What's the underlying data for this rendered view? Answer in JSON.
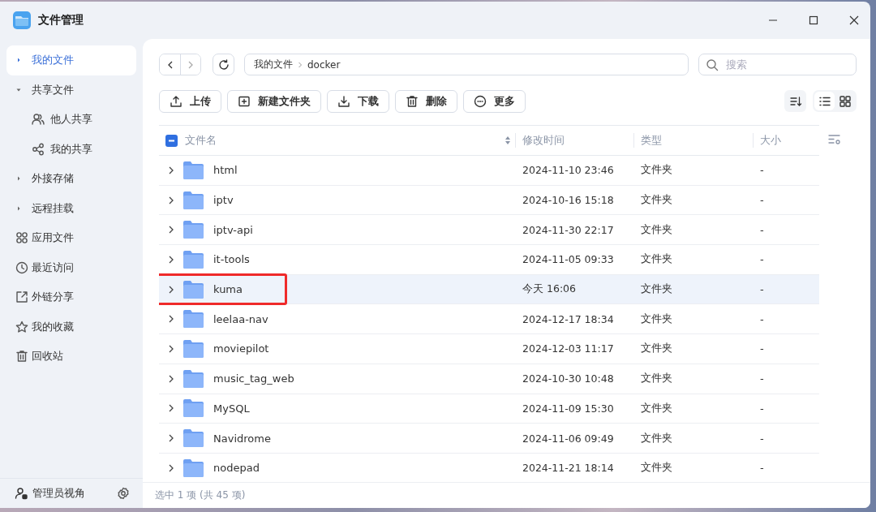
{
  "window": {
    "title": "文件管理"
  },
  "sidebar": {
    "items": [
      {
        "label": "我的文件",
        "kind": "group",
        "selected": true,
        "expanded": false
      },
      {
        "label": "共享文件",
        "kind": "group",
        "selected": false,
        "expanded": true,
        "children": [
          {
            "label": "他人共享",
            "selected": false
          },
          {
            "label": "我的共享",
            "selected": false
          }
        ]
      },
      {
        "label": "外接存储",
        "kind": "group",
        "selected": false,
        "expanded": false
      },
      {
        "label": "远程挂载",
        "kind": "group",
        "selected": false,
        "expanded": false
      },
      {
        "label": "应用文件",
        "kind": "link",
        "selected": false
      },
      {
        "label": "最近访问",
        "kind": "link",
        "selected": false
      },
      {
        "label": "外链分享",
        "kind": "link",
        "selected": false
      },
      {
        "label": "我的收藏",
        "kind": "link",
        "selected": false
      },
      {
        "label": "回收站",
        "kind": "link",
        "selected": false
      }
    ],
    "footer": {
      "label": "管理员视角"
    }
  },
  "toolbar": {
    "breadcrumb": [
      "我的文件",
      "docker"
    ],
    "search": {
      "placeholder": "搜索"
    },
    "actions": [
      "上传",
      "新建文件夹",
      "下载",
      "删除",
      "更多"
    ],
    "view_modes": [
      {
        "kind": "list",
        "selected": true
      },
      {
        "kind": "grid",
        "selected": false
      }
    ]
  },
  "table": {
    "header_checkbox": {
      "indeterminate": true
    },
    "columns": [
      "文件名",
      "修改时间",
      "类型",
      "大小"
    ],
    "rows": [
      {
        "name": "html",
        "modified": "2024-11-10 23:46",
        "type": "文件夹",
        "size": "-",
        "selected": false,
        "annotated": false
      },
      {
        "name": "iptv",
        "modified": "2024-10-16 15:18",
        "type": "文件夹",
        "size": "-",
        "selected": false,
        "annotated": false
      },
      {
        "name": "iptv-api",
        "modified": "2024-11-30 22:17",
        "type": "文件夹",
        "size": "-",
        "selected": false,
        "annotated": false
      },
      {
        "name": "it-tools",
        "modified": "2024-11-05 09:33",
        "type": "文件夹",
        "size": "-",
        "selected": false,
        "annotated": false
      },
      {
        "name": "kuma",
        "modified": "今天 16:06",
        "type": "文件夹",
        "size": "-",
        "selected": true,
        "annotated": true
      },
      {
        "name": "leelaa-nav",
        "modified": "2024-12-17 18:34",
        "type": "文件夹",
        "size": "-",
        "selected": false,
        "annotated": false
      },
      {
        "name": "moviepilot",
        "modified": "2024-12-03 11:17",
        "type": "文件夹",
        "size": "-",
        "selected": false,
        "annotated": false
      },
      {
        "name": "music_tag_web",
        "modified": "2024-10-30 10:48",
        "type": "文件夹",
        "size": "-",
        "selected": false,
        "annotated": false
      },
      {
        "name": "MySQL",
        "modified": "2024-11-09 15:30",
        "type": "文件夹",
        "size": "-",
        "selected": false,
        "annotated": false
      },
      {
        "name": "Navidrome",
        "modified": "2024-11-06 09:49",
        "type": "文件夹",
        "size": "-",
        "selected": false,
        "annotated": false
      },
      {
        "name": "nodepad",
        "modified": "2024-11-21 18:14",
        "type": "文件夹",
        "size": "-",
        "selected": false,
        "annotated": false
      }
    ]
  },
  "status_bar": "选中 1 项 (共 45 项)"
}
